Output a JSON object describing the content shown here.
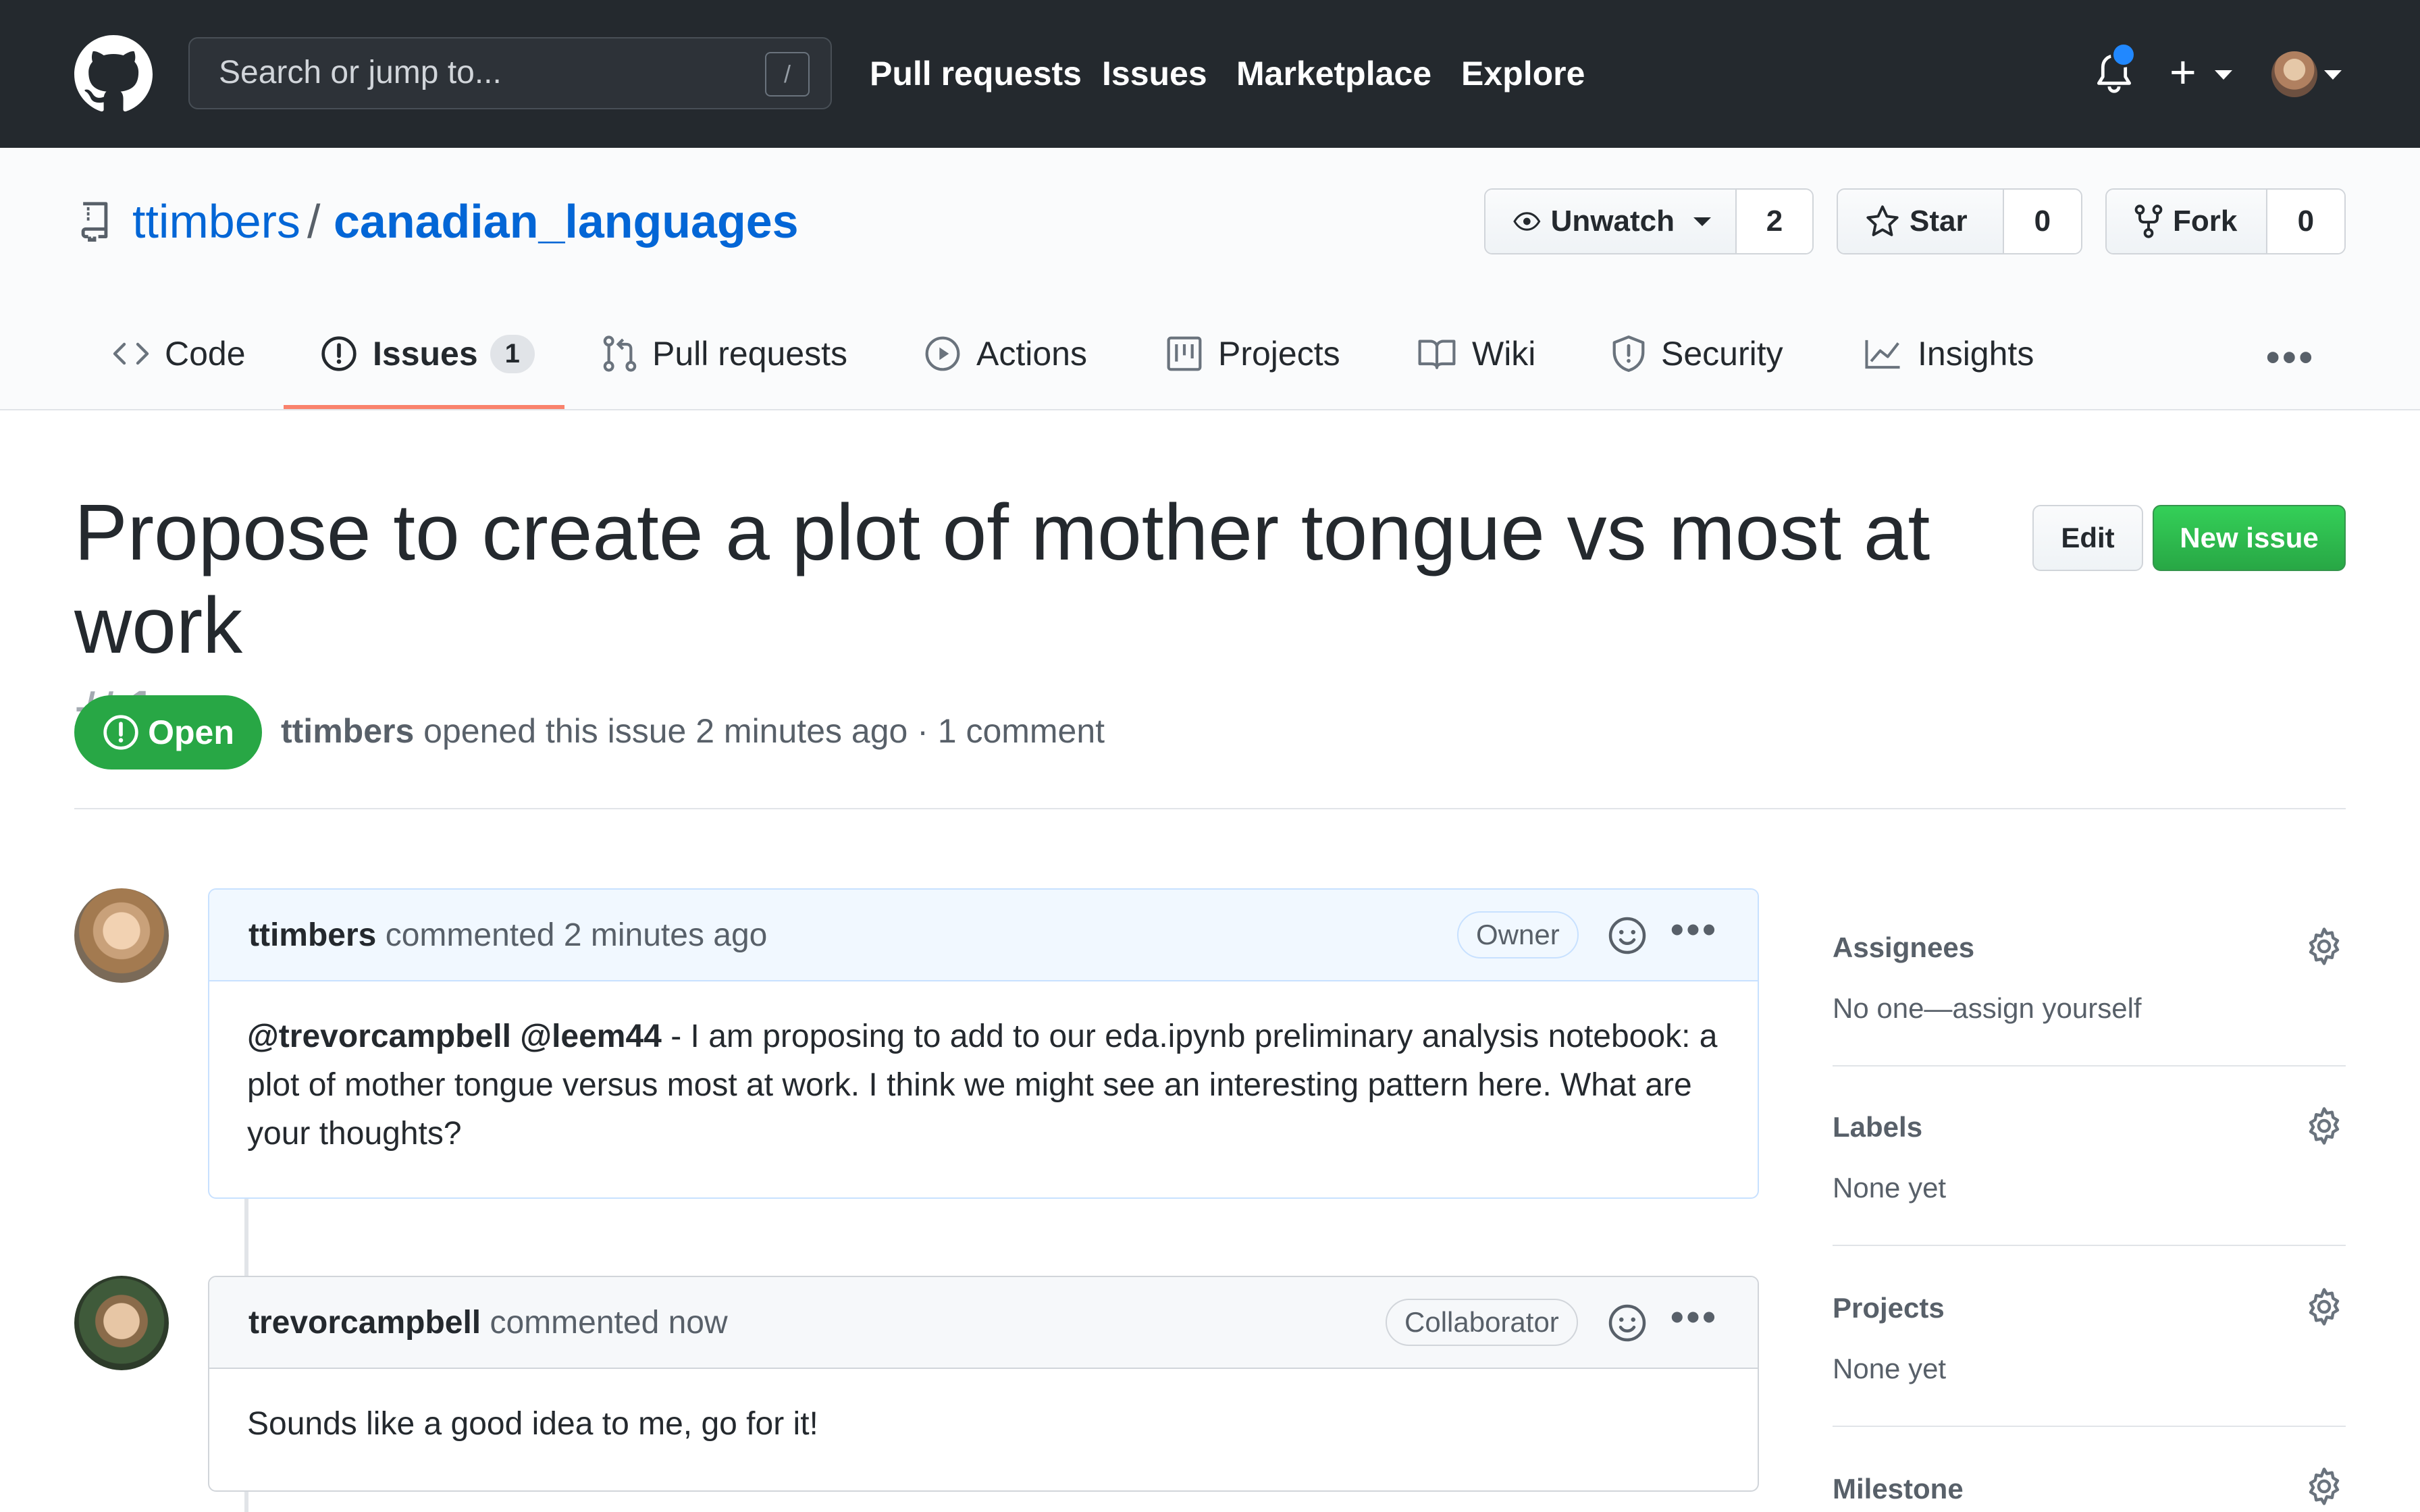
{
  "header": {
    "search_placeholder": "Search or jump to...",
    "search_shortcut": "/",
    "nav": [
      "Pull requests",
      "Issues",
      "Marketplace",
      "Explore"
    ]
  },
  "repo": {
    "owner": "ttimbers",
    "separator": "/",
    "name": "canadian_languages",
    "watch": {
      "label": "Unwatch",
      "count": "2"
    },
    "star": {
      "label": "Star",
      "count": "0"
    },
    "fork": {
      "label": "Fork",
      "count": "0"
    }
  },
  "tabs": {
    "code": "Code",
    "issues": "Issues",
    "issues_count": "1",
    "pull_requests": "Pull requests",
    "actions": "Actions",
    "projects": "Projects",
    "wiki": "Wiki",
    "security": "Security",
    "insights": "Insights",
    "active": "Issues"
  },
  "issue": {
    "title": "Propose to create a plot of mother tongue vs most at work",
    "number": "#1",
    "edit_label": "Edit",
    "new_issue_label": "New issue",
    "state": "Open",
    "author": "ttimbers",
    "meta": "opened this issue 2 minutes ago · 1 comment"
  },
  "comments": [
    {
      "author": "ttimbers",
      "action": "commented 2 minutes ago",
      "role": "Owner",
      "mentions": "@trevorcampbell @leem44",
      "body": " - I am proposing to add to our eda.ipynb preliminary analysis notebook: a plot of mother tongue versus most at work. I think we might see an interesting pattern here. What are your thoughts?"
    },
    {
      "author": "trevorcampbell",
      "action": "commented now",
      "role": "Collaborator",
      "body": "Sounds like a good idea to me, go for it!"
    }
  ],
  "sidebar": {
    "assignees": {
      "heading": "Assignees",
      "value": "No one—assign yourself"
    },
    "labels": {
      "heading": "Labels",
      "value": "None yet"
    },
    "projects": {
      "heading": "Projects",
      "value": "None yet"
    },
    "milestone": {
      "heading": "Milestone"
    }
  },
  "colors": {
    "header_bg": "#24292e",
    "link": "#0366d6",
    "open_green": "#28a745",
    "tab_underline": "#f9826c",
    "notification_dot": "#2188ff"
  }
}
